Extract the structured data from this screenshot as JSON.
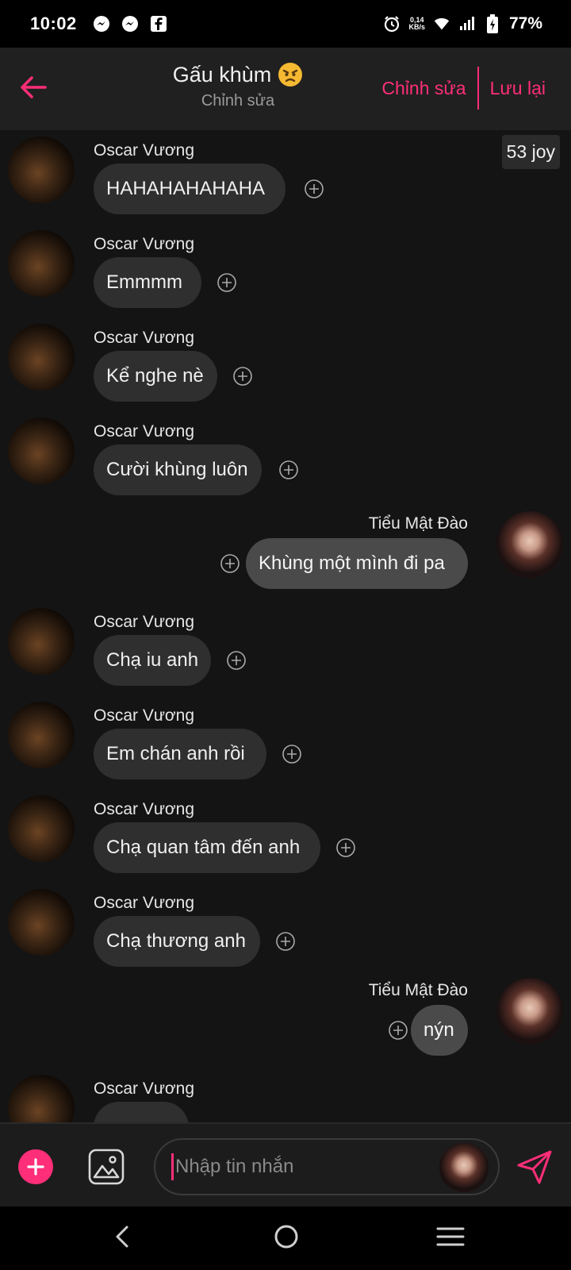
{
  "status_bar": {
    "time": "10:02",
    "net_speed_value": "0,14",
    "net_speed_unit": "KB/s",
    "battery": "77%"
  },
  "header": {
    "title": "Gấu khùm",
    "subtitle": "Chỉnh sửa",
    "edit_label": "Chỉnh sửa",
    "save_label": "Lưu lại"
  },
  "badge": {
    "text": "53 joy"
  },
  "messages": [
    {
      "sender": "Oscar Vương",
      "text": "HAHAHAHAHAHA",
      "side": "left"
    },
    {
      "sender": "Oscar Vương",
      "text": "Emmmm",
      "side": "left"
    },
    {
      "sender": "Oscar Vương",
      "text": "Kể nghe nè",
      "side": "left"
    },
    {
      "sender": "Oscar Vương",
      "text": "Cười khùng luôn",
      "side": "left"
    },
    {
      "sender": "Tiểu Mật Đào",
      "text": "Khùng một mình đi pa",
      "side": "right"
    },
    {
      "sender": "Oscar Vương",
      "text": "Chạ iu anh",
      "side": "left"
    },
    {
      "sender": "Oscar Vương",
      "text": "Em chán anh rồi",
      "side": "left"
    },
    {
      "sender": "Oscar Vương",
      "text": "Chạ quan tâm đến anh",
      "side": "left"
    },
    {
      "sender": "Oscar Vương",
      "text": "Chạ thương anh",
      "side": "left"
    },
    {
      "sender": "Tiểu Mật Đào",
      "text": "nýn",
      "side": "right"
    },
    {
      "sender": "Oscar Vương",
      "text": "",
      "side": "left"
    }
  ],
  "input": {
    "placeholder": "Nhập tin nhắn"
  },
  "colors": {
    "accent": "#ff2e78",
    "background": "#141414",
    "bubble_in": "#2f2f2f",
    "bubble_out": "#4a4a4a"
  }
}
